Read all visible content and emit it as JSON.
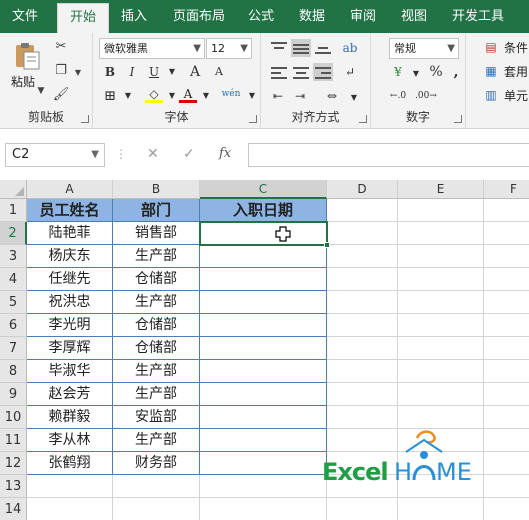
{
  "ribbon_tabs": [
    {
      "label": "文件"
    },
    {
      "label": "开始",
      "active": true
    },
    {
      "label": "插入"
    },
    {
      "label": "页面布局"
    },
    {
      "label": "公式"
    },
    {
      "label": "数据"
    },
    {
      "label": "审阅"
    },
    {
      "label": "视图"
    },
    {
      "label": "开发工具"
    }
  ],
  "clipboard": {
    "paste_label": "粘贴",
    "group_label": "剪贴板"
  },
  "font": {
    "name": "微软雅黑",
    "size": "12",
    "group_label": "字体",
    "bold": "B",
    "italic": "I",
    "underline": "U",
    "grow": "A",
    "shrink": "A",
    "phonetic": "wén",
    "font_color_letter": "A"
  },
  "alignment": {
    "group_label": "对齐方式"
  },
  "number": {
    "format": "常规",
    "group_label": "数字",
    "percent": "%",
    "comma": ","
  },
  "styles": {
    "conditional": "条件",
    "table": "套用",
    "cell": "单元"
  },
  "formula_bar": {
    "name_box": "C2",
    "cancel": "✕",
    "enter": "✓",
    "fx": "fx",
    "value": ""
  },
  "columns": [
    "A",
    "B",
    "C",
    "D",
    "E",
    "F"
  ],
  "rows": [
    "1",
    "2",
    "3",
    "4",
    "5",
    "6",
    "7",
    "8",
    "9",
    "10",
    "11",
    "12",
    "13",
    "14"
  ],
  "table": {
    "headers": [
      "员工姓名",
      "部门",
      "入职日期"
    ],
    "rows": [
      [
        "陆艳菲",
        "销售部",
        ""
      ],
      [
        "杨庆东",
        "生产部",
        ""
      ],
      [
        "任继先",
        "仓储部",
        ""
      ],
      [
        "祝洪忠",
        "生产部",
        ""
      ],
      [
        "李光明",
        "仓储部",
        ""
      ],
      [
        "李厚辉",
        "仓储部",
        ""
      ],
      [
        "毕淑华",
        "生产部",
        ""
      ],
      [
        "赵会芳",
        "生产部",
        ""
      ],
      [
        "赖群毅",
        "安监部",
        ""
      ],
      [
        "李从林",
        "生产部",
        ""
      ],
      [
        "张鹤翔",
        "财务部",
        ""
      ]
    ]
  },
  "watermark": {
    "part1": "Excel",
    "part2": "H",
    "part3": "ME"
  },
  "colors": {
    "excel_green": "#217346",
    "header_blue": "#8db4e2",
    "table_border": "#4d7db2",
    "logo_green": "#1e9e45",
    "logo_blue": "#2a8fd8",
    "logo_orange": "#f08a24"
  }
}
